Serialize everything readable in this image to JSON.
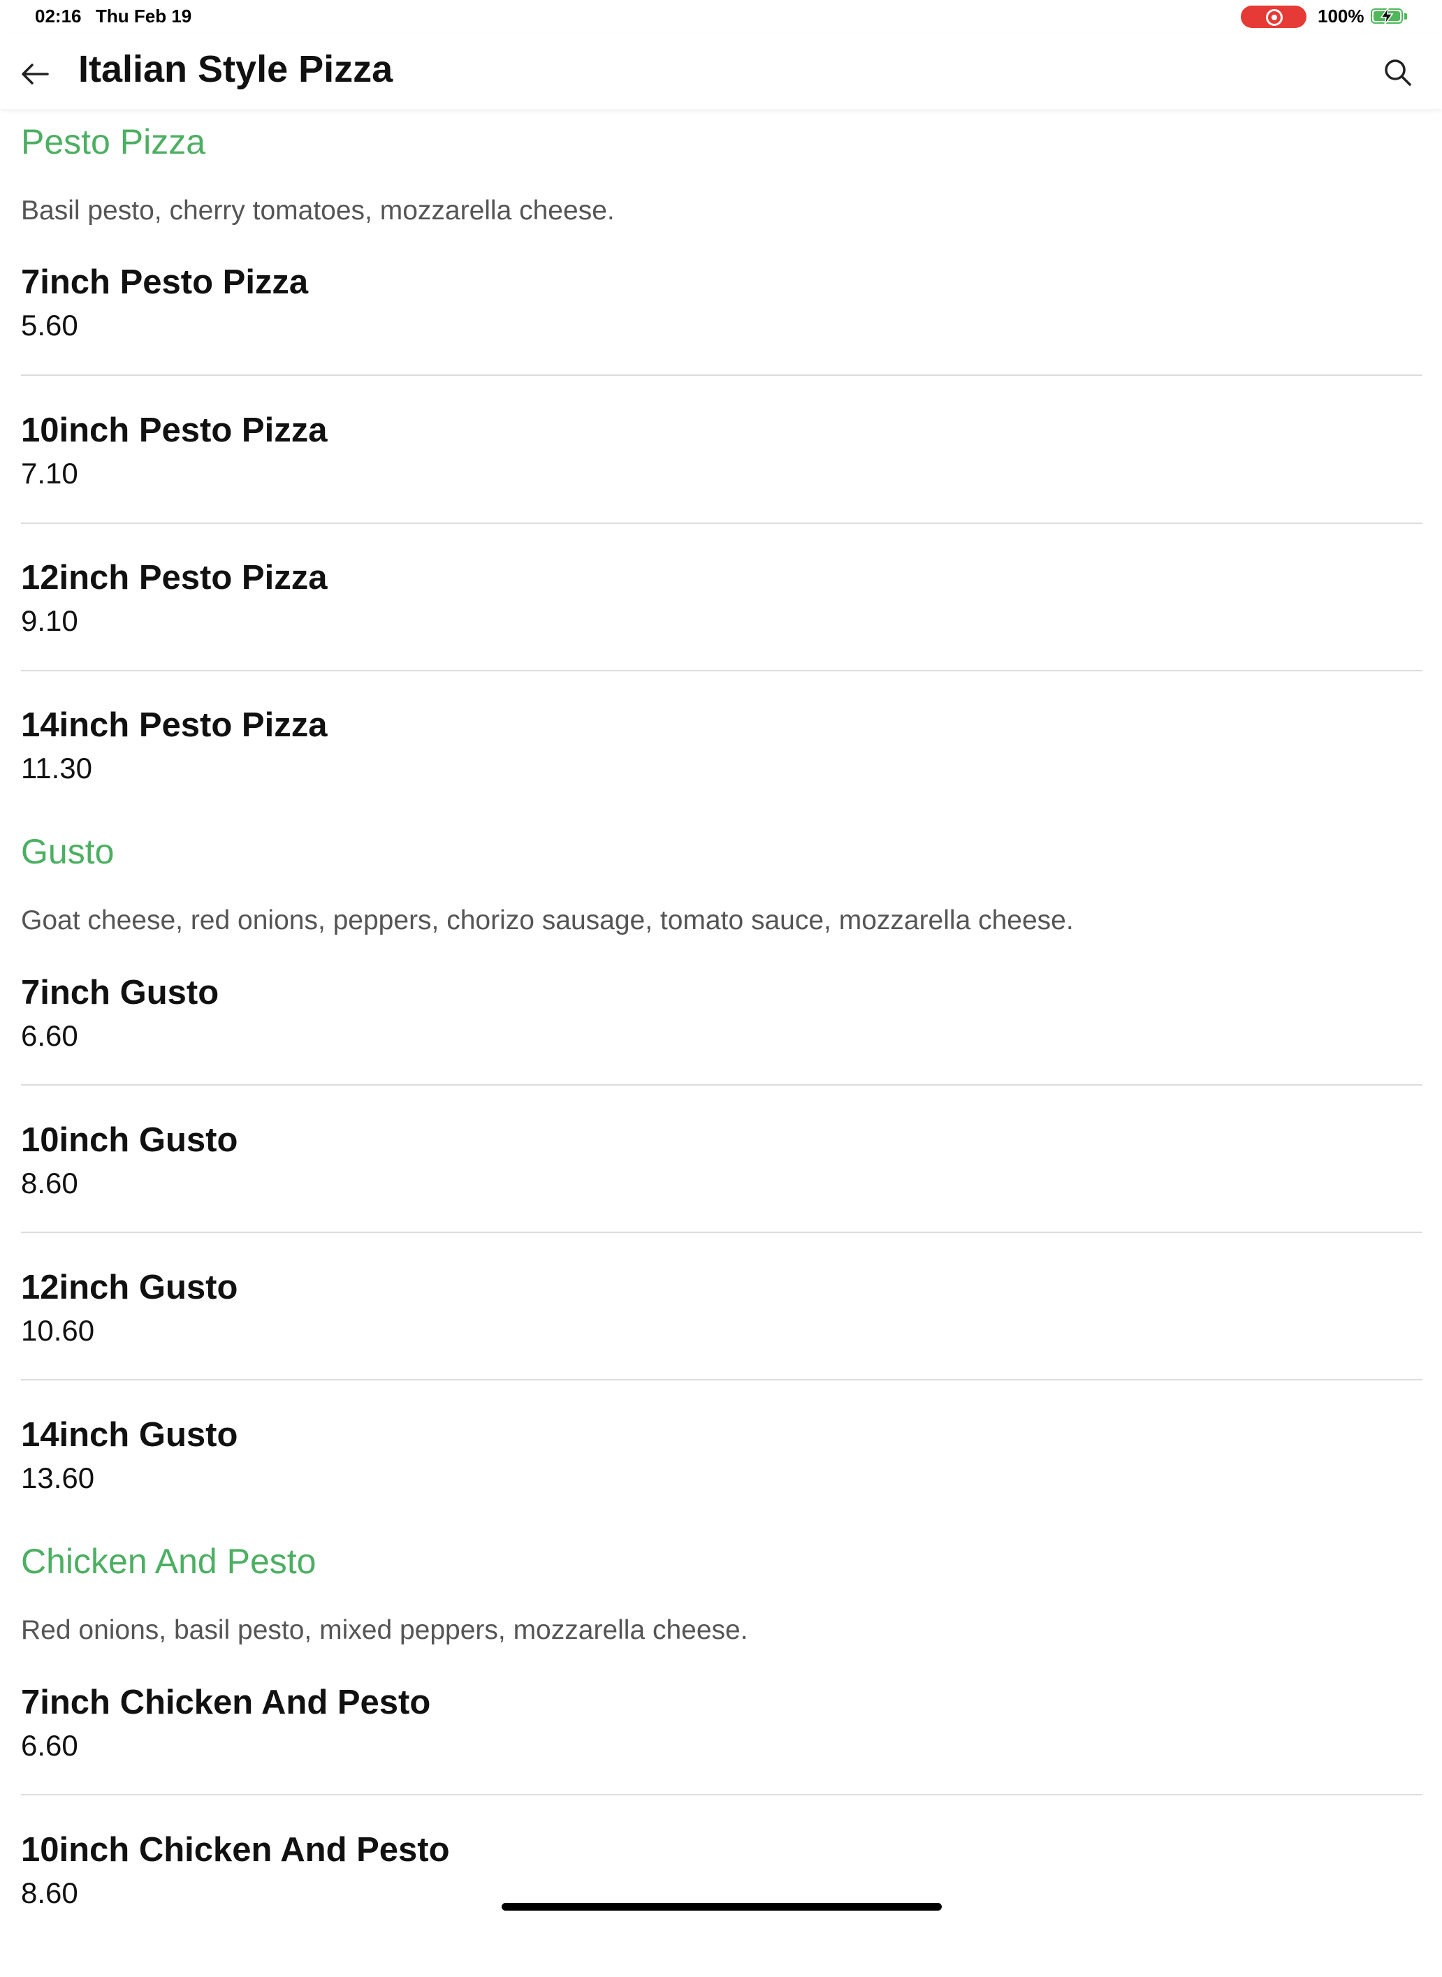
{
  "status": {
    "time": "02:16",
    "date": "Thu Feb 19",
    "battery": "100%"
  },
  "header": {
    "title": "Italian Style Pizza"
  },
  "colors": {
    "accent": "#4caf62",
    "record": "#e53a35",
    "battery": "#4fb85b"
  },
  "icons": {
    "back": "arrow-left-icon",
    "search": "search-icon"
  },
  "sections": [
    {
      "title": "Pesto Pizza",
      "description": "Basil pesto, cherry tomatoes, mozzarella cheese.",
      "items": [
        {
          "name": "7inch Pesto Pizza",
          "price": "5.60"
        },
        {
          "name": "10inch Pesto Pizza",
          "price": "7.10"
        },
        {
          "name": "12inch Pesto Pizza",
          "price": "9.10"
        },
        {
          "name": "14inch Pesto Pizza",
          "price": "11.30"
        }
      ]
    },
    {
      "title": "Gusto",
      "description": "Goat cheese, red onions, peppers, chorizo sausage, tomato sauce, mozzarella cheese.",
      "items": [
        {
          "name": "7inch Gusto",
          "price": "6.60"
        },
        {
          "name": "10inch Gusto",
          "price": "8.60"
        },
        {
          "name": "12inch Gusto",
          "price": "10.60"
        },
        {
          "name": "14inch Gusto",
          "price": "13.60"
        }
      ]
    },
    {
      "title": "Chicken And Pesto",
      "description": "Red onions, basil pesto, mixed peppers, mozzarella cheese.",
      "items": [
        {
          "name": "7inch Chicken And Pesto",
          "price": "6.60"
        },
        {
          "name": "10inch Chicken And Pesto",
          "price": "8.60"
        }
      ]
    }
  ]
}
